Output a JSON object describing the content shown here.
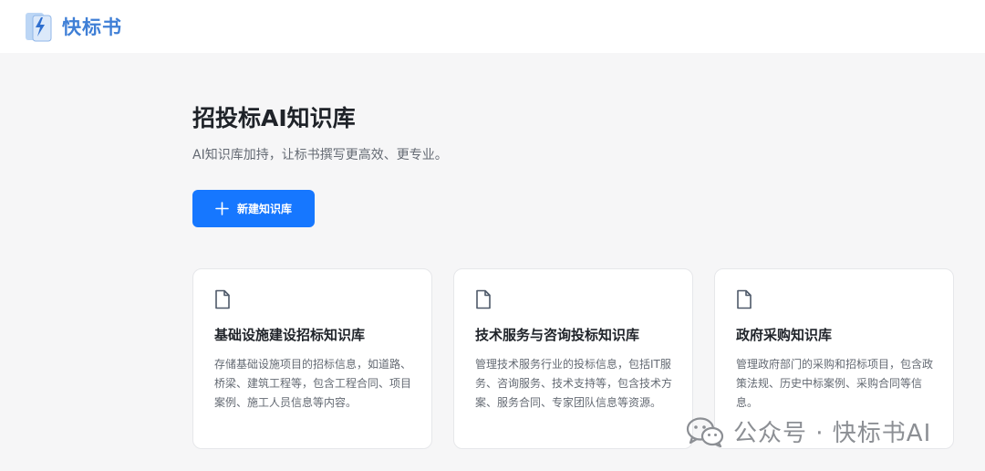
{
  "brand": {
    "name": "快标书",
    "logo_icon": "lightning-phone-icon",
    "color": "#3f7fd6"
  },
  "page": {
    "title": "招投标AI知识库",
    "subtitle": "AI知识库加持，让标书撰写更高效、更专业。"
  },
  "actions": {
    "new_label": "新建知识库",
    "new_icon": "plus-icon",
    "accent": "#1677ff"
  },
  "cards": [
    {
      "icon": "document-icon",
      "title": "基础设施建设招标知识库",
      "description": "存储基础设施项目的招标信息，如道路、桥梁、建筑工程等，包含工程合同、项目案例、施工人员信息等内容。"
    },
    {
      "icon": "document-icon",
      "title": "技术服务与咨询投标知识库",
      "description": "管理技术服务行业的投标信息，包括IT服务、咨询服务、技术支持等，包含技术方案、服务合同、专家团队信息等资源。"
    },
    {
      "icon": "document-icon",
      "title": "政府采购知识库",
      "description": "管理政府部门的采购和招标项目，包含政策法规、历史中标案例、采购合同等信息。"
    }
  ],
  "watermark": {
    "icon": "wechat-icon",
    "text": "公众号 · 快标书AI"
  }
}
